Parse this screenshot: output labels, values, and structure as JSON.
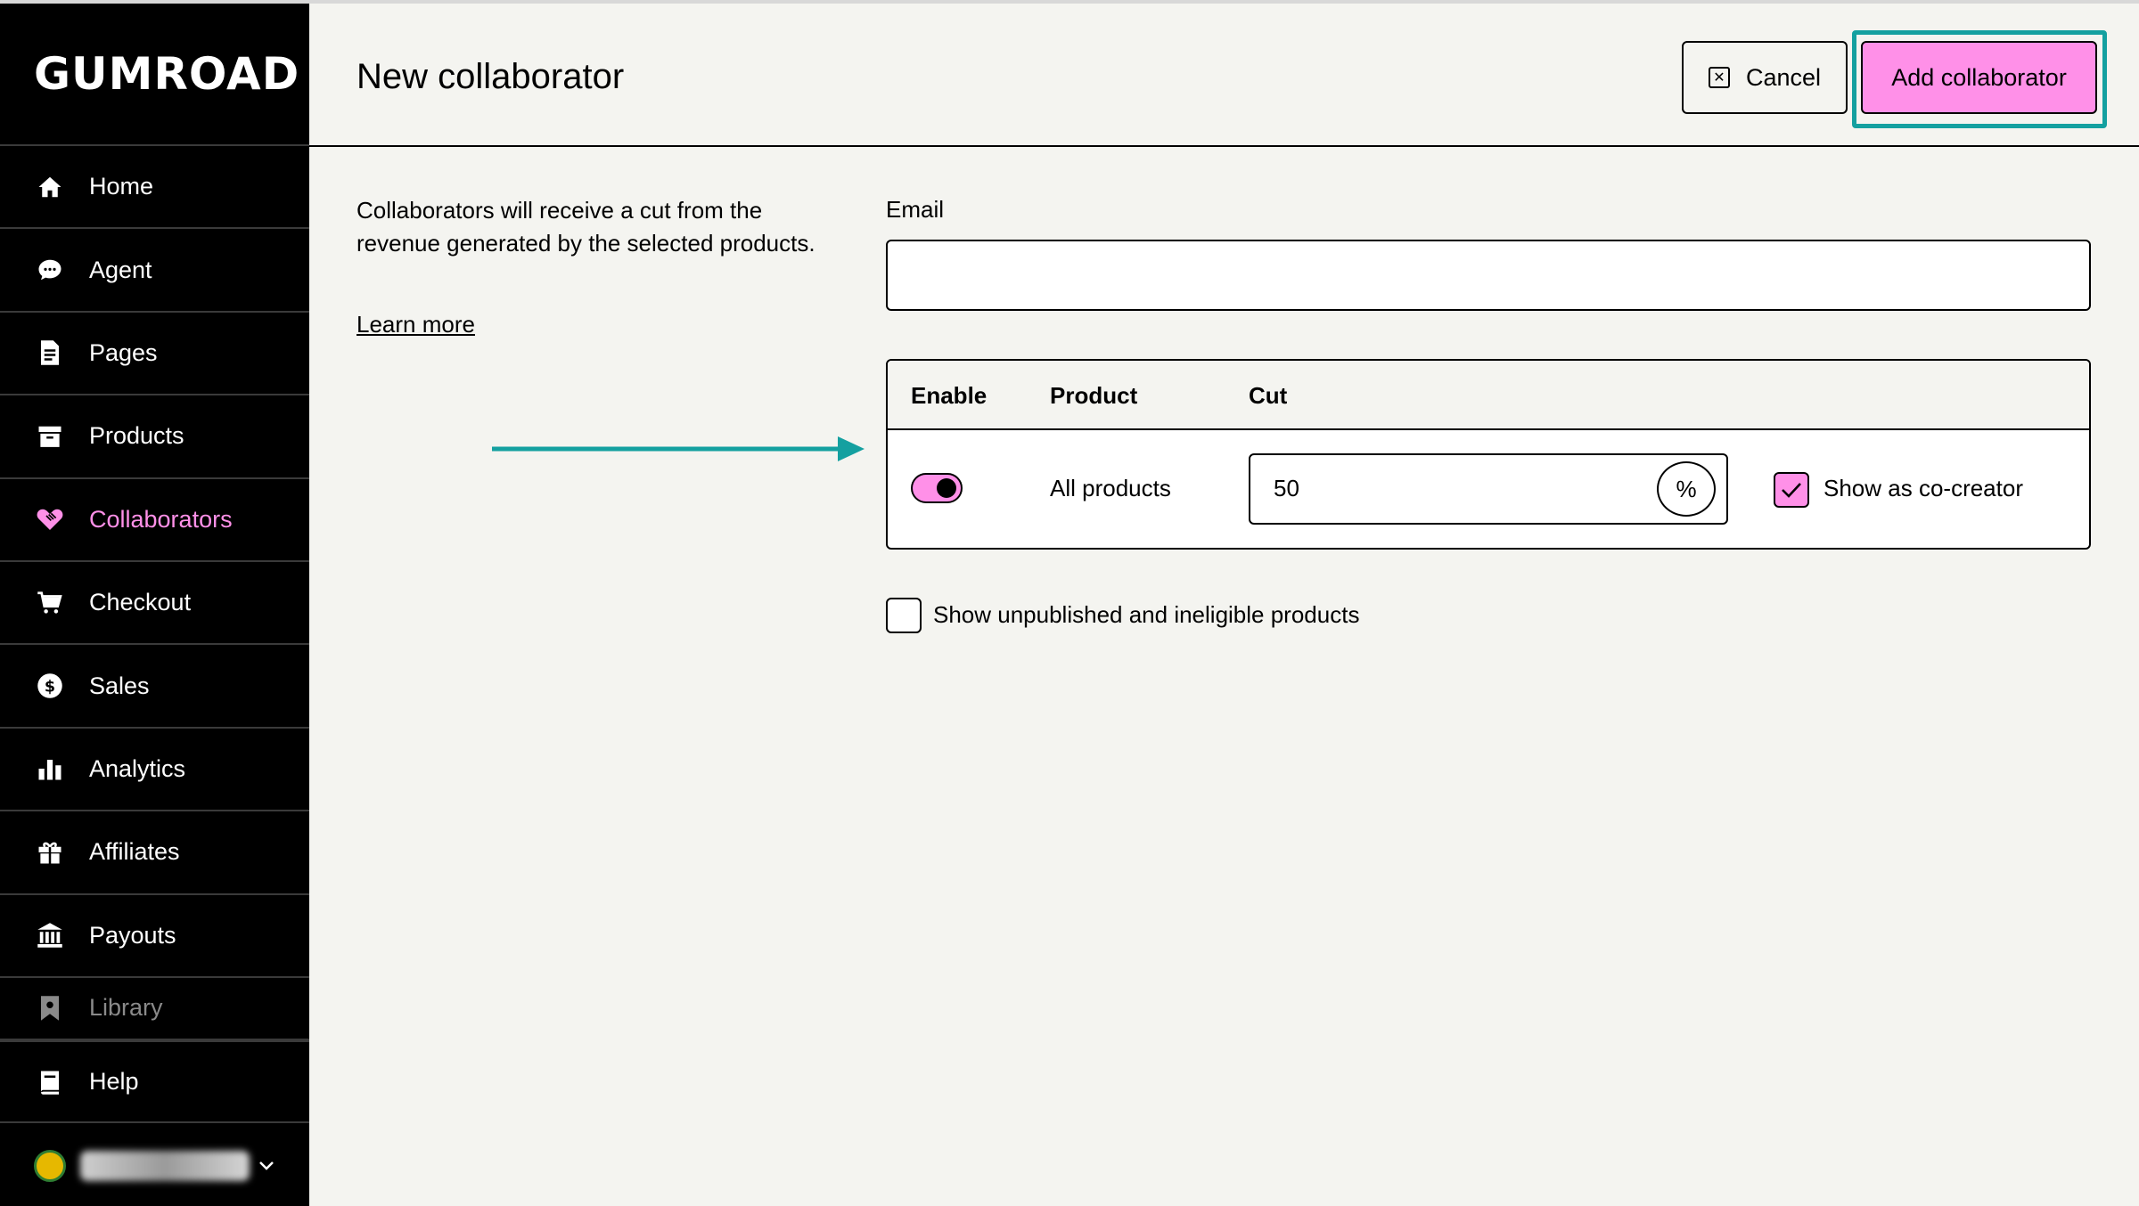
{
  "app": {
    "logo_text": "GUMROAD"
  },
  "sidebar": {
    "items": [
      {
        "label": "Home",
        "icon": "home-icon"
      },
      {
        "label": "Agent",
        "icon": "chat-bubble-icon"
      },
      {
        "label": "Pages",
        "icon": "document-icon"
      },
      {
        "label": "Products",
        "icon": "archive-box-icon"
      },
      {
        "label": "Collaborators",
        "icon": "handshake-icon",
        "active": true
      },
      {
        "label": "Checkout",
        "icon": "cart-icon"
      },
      {
        "label": "Sales",
        "icon": "dollar-circle-icon"
      },
      {
        "label": "Analytics",
        "icon": "bar-chart-icon"
      },
      {
        "label": "Affiliates",
        "icon": "gift-icon"
      },
      {
        "label": "Payouts",
        "icon": "bank-icon"
      },
      {
        "label": "Library",
        "icon": "bookmark-icon"
      }
    ],
    "help": {
      "label": "Help",
      "icon": "book-icon"
    }
  },
  "header": {
    "title": "New collaborator",
    "cancel_label": "Cancel",
    "add_label": "Add collaborator"
  },
  "intro": {
    "description": "Collaborators will receive a cut from the revenue generated by the selected products.",
    "learn_more": "Learn more"
  },
  "form": {
    "email_label": "Email",
    "email_value": "",
    "table": {
      "headers": [
        "Enable",
        "Product",
        "Cut"
      ],
      "rows": [
        {
          "enabled": true,
          "product": "All products",
          "cut": "50",
          "cut_unit": "%",
          "show_as_cocreator": true,
          "cocreator_label": "Show as co-creator"
        }
      ]
    },
    "unpublished_label": "Show unpublished and ineligible products",
    "unpublished_checked": false
  },
  "colors": {
    "accent": "#ff90e8",
    "highlight": "#14a0a0"
  }
}
